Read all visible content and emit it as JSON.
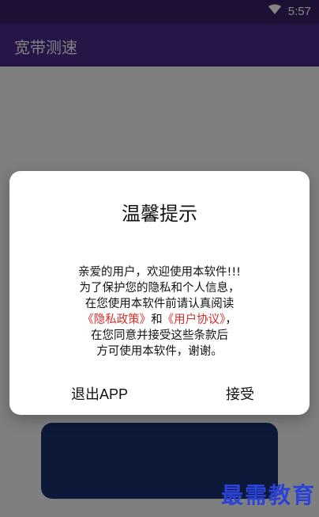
{
  "status_bar": {
    "time": "5:57",
    "icons": [
      "wifi-icon",
      "signal-icon",
      "battery-icon"
    ]
  },
  "app_bar": {
    "title": "宽带测速"
  },
  "dialog": {
    "title": "温馨提示",
    "message": {
      "line1": "亲爱的用户，欢迎使用本软件!!!",
      "line2": "为了保护您的隐私和个人信息，",
      "line3": "在您使用本软件前请认真阅读",
      "line4_link1": "《隐私政策》",
      "line4_mid": "和",
      "line4_link2": "《用户协议》",
      "line4_end": "，",
      "line5": "在您同意并接受这些条款后",
      "line6": "方可使用本软件，谢谢。"
    },
    "buttons": {
      "exit": "退出APP",
      "accept": "接受"
    }
  },
  "watermark": {
    "text": "最需教育"
  },
  "colors": {
    "status_bar": "#3b1f66",
    "app_bar": "#4a2a86",
    "background_button": "#18306b",
    "link": "#d32f2f",
    "watermark": "#2b42d6"
  }
}
